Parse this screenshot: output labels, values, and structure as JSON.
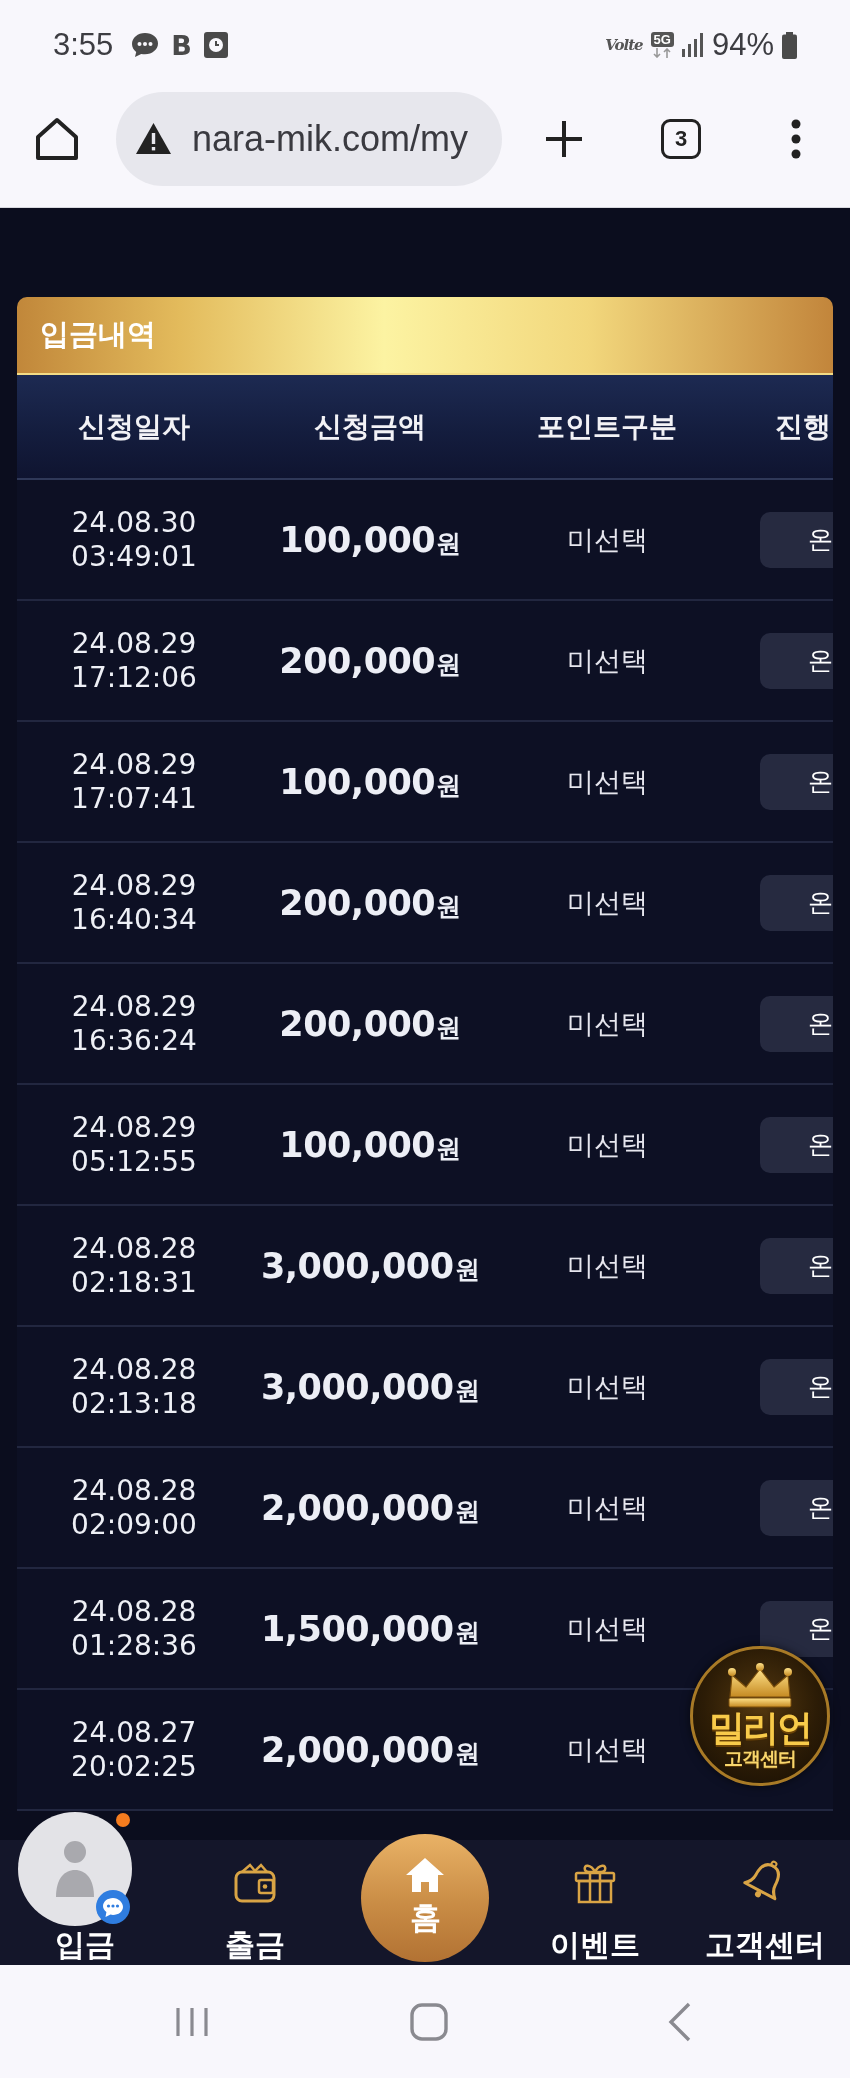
{
  "status_bar": {
    "time": "3:55",
    "notifications": [
      {
        "kind": "chat"
      },
      {
        "kind": "letter",
        "letter": "B"
      },
      {
        "kind": "clock"
      }
    ],
    "volte": "Volte",
    "network": "5G",
    "battery": "94%"
  },
  "browser": {
    "url": "nara-mik.com/my",
    "tab_count": "3"
  },
  "section": {
    "title": "입금내역"
  },
  "table": {
    "columns": [
      "신청일자",
      "신청금액",
      "포인트구분",
      "진행"
    ],
    "rows": [
      {
        "date": "24.08.30",
        "time": "03:49:01",
        "amount": "100,000",
        "unit": "원",
        "point_type": "미선택",
        "status": "온"
      },
      {
        "date": "24.08.29",
        "time": "17:12:06",
        "amount": "200,000",
        "unit": "원",
        "point_type": "미선택",
        "status": "온"
      },
      {
        "date": "24.08.29",
        "time": "17:07:41",
        "amount": "100,000",
        "unit": "원",
        "point_type": "미선택",
        "status": "온"
      },
      {
        "date": "24.08.29",
        "time": "16:40:34",
        "amount": "200,000",
        "unit": "원",
        "point_type": "미선택",
        "status": "온"
      },
      {
        "date": "24.08.29",
        "time": "16:36:24",
        "amount": "200,000",
        "unit": "원",
        "point_type": "미선택",
        "status": "온"
      },
      {
        "date": "24.08.29",
        "time": "05:12:55",
        "amount": "100,000",
        "unit": "원",
        "point_type": "미선택",
        "status": "온"
      },
      {
        "date": "24.08.28",
        "time": "02:18:31",
        "amount": "3,000,000",
        "unit": "원",
        "point_type": "미선택",
        "status": "온"
      },
      {
        "date": "24.08.28",
        "time": "02:13:18",
        "amount": "3,000,000",
        "unit": "원",
        "point_type": "미선택",
        "status": "온"
      },
      {
        "date": "24.08.28",
        "time": "02:09:00",
        "amount": "2,000,000",
        "unit": "원",
        "point_type": "미선택",
        "status": "온"
      },
      {
        "date": "24.08.28",
        "time": "01:28:36",
        "amount": "1,500,000",
        "unit": "원",
        "point_type": "미선택",
        "status": "온"
      },
      {
        "date": "24.08.27",
        "time": "20:02:25",
        "amount": "2,000,000",
        "unit": "원",
        "point_type": "미선택"
      }
    ]
  },
  "floating": {
    "support_badge": {
      "title": "밀리언",
      "subtitle": "고객센터"
    },
    "chat_widget": {
      "unread": true
    }
  },
  "bottom_nav": [
    {
      "label": "입금",
      "kind": "tab"
    },
    {
      "label": "출금",
      "kind": "tab"
    },
    {
      "label": "홈",
      "kind": "center"
    },
    {
      "label": "이벤트",
      "kind": "tab"
    },
    {
      "label": "고객센터",
      "kind": "tab"
    }
  ]
}
